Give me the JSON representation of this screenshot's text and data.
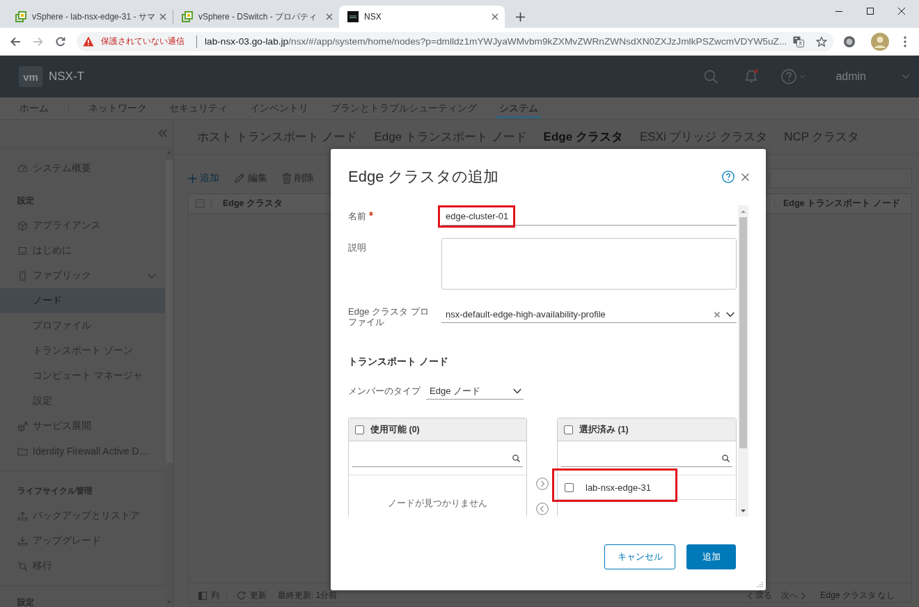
{
  "browser": {
    "tabs": [
      {
        "title": "vSphere - lab-nsx-edge-31 - サマ",
        "kind": "vsphere",
        "selected": false
      },
      {
        "title": "vSphere - DSwitch - プロパティ",
        "kind": "vsphere",
        "selected": false
      },
      {
        "title": "NSX",
        "kind": "nsx",
        "selected": true
      }
    ],
    "forward_disabled": true,
    "security_warning": "保護されていない通信",
    "url_host": "lab-nsx-03.go-lab.jp",
    "url_path": "/nsx/#/app/system/home/nodes?p=dmlldz1mYWJyaWMvbm9kZXMvZWRnZWNsdXN0ZXJzJmlkPSZwcmVDYW5uZ..."
  },
  "header": {
    "logo": "vm",
    "product": "NSX-T",
    "alerts_unread": true,
    "user": "admin"
  },
  "nav": [
    {
      "label": "ホーム",
      "selected": false
    },
    {
      "label": "ネットワーク",
      "selected": false
    },
    {
      "label": "セキュリティ",
      "selected": false
    },
    {
      "label": "インベントリ",
      "selected": false
    },
    {
      "label": "プランとトラブルシューティング",
      "selected": false
    },
    {
      "label": "システム",
      "selected": true
    }
  ],
  "sidebar": {
    "sections": [
      {
        "items": [
          {
            "label": "システム概要",
            "selected": false
          }
        ]
      },
      {
        "title": "設定",
        "items": [
          {
            "label": "アプライアンス",
            "selected": false
          },
          {
            "label": "はじめに",
            "selected": false
          },
          {
            "label": "ファブリック",
            "selected": false,
            "expanded": true,
            "children": [
              {
                "label": "ノード",
                "selected": true
              },
              {
                "label": "プロファイル",
                "selected": false
              },
              {
                "label": "トランスポート ゾーン",
                "selected": false
              },
              {
                "label": "コンピュート マネージャ",
                "selected": false
              },
              {
                "label": "設定",
                "selected": false
              }
            ]
          },
          {
            "label": "サービス展開",
            "selected": false
          },
          {
            "label": "Identity Firewall Active D…",
            "selected": false
          }
        ]
      },
      {
        "title": "ライフサイクル管理",
        "items": [
          {
            "label": "バックアップとリストア",
            "selected": false
          },
          {
            "label": "アップグレード",
            "selected": false
          },
          {
            "label": "移行",
            "selected": false
          }
        ]
      },
      {
        "title": "設定"
      }
    ]
  },
  "subtabs": [
    {
      "label": "ホスト トランスポート ノード",
      "selected": false
    },
    {
      "label": "Edge トランスポート ノード",
      "selected": false
    },
    {
      "label": "Edge クラスタ",
      "selected": true
    },
    {
      "label": "ESXi ブリッジ クラスタ",
      "selected": false
    },
    {
      "label": "NCP クラスタ",
      "selected": false
    }
  ],
  "toolbar": [
    {
      "label": "追加",
      "disabled": false
    },
    {
      "label": "編集",
      "disabled": true
    },
    {
      "label": "削除",
      "disabled": true
    }
  ],
  "table": {
    "select_all_checked": false,
    "columns": [
      "Edge クラスタ",
      "Edge トランスポート ノード"
    ],
    "footer": {
      "columns_button": "列",
      "refresh_button": "更新",
      "last_updated": "最終更新: 1分前",
      "pager": [
        {
          "label": "戻る",
          "disabled": true
        },
        {
          "label": "次へ",
          "disabled": true
        }
      ],
      "summary": "Edge クラスタ なし"
    }
  },
  "modal": {
    "title": "Edge クラスタの追加",
    "fields": [
      {
        "kind": "text",
        "label": "名前",
        "required": true,
        "value": "edge-cluster-01",
        "highlighted": true
      },
      {
        "kind": "textarea",
        "label": "説明",
        "required": false
      },
      {
        "kind": "select",
        "label": "Edge クラスタ プロファイル",
        "required": false,
        "value": "nsx-default-edge-high-availability-profile",
        "clearable": true
      }
    ],
    "section_title": "トランスポート ノード",
    "member_type": {
      "label": "メンバーのタイプ",
      "value": "Edge ノード"
    },
    "lists": [
      {
        "title": "使用可能 (0)",
        "checked": false,
        "empty_text": "ノードが見つかりません"
      },
      {
        "title": "選択済み (1)",
        "checked": false,
        "items": [
          {
            "label": "lab-nsx-edge-31",
            "checked": false,
            "highlighted": true
          }
        ]
      }
    ],
    "buttons": [
      {
        "label": "キャンセル",
        "kind": "secondary"
      },
      {
        "label": "追加",
        "kind": "primary"
      }
    ]
  }
}
